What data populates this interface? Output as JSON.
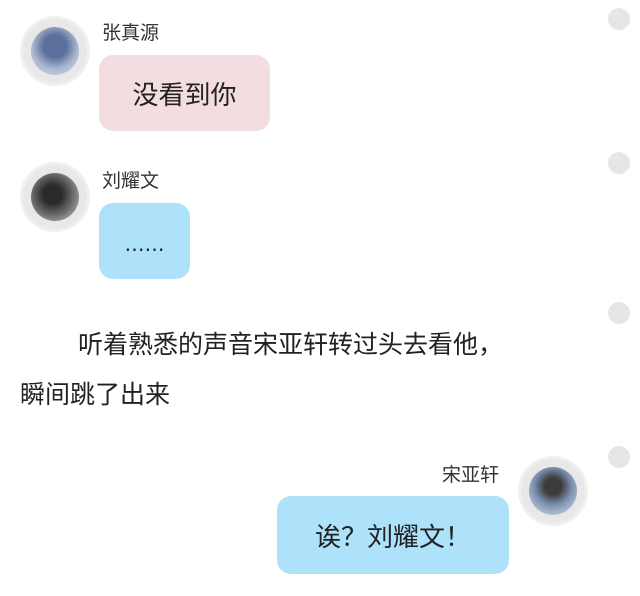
{
  "messages": [
    {
      "sender": "张真源",
      "text": "没看到你",
      "side": "left",
      "bubble_color": "#f4dde0"
    },
    {
      "sender": "刘耀文",
      "text": "……",
      "side": "left",
      "bubble_color": "#aee2fb"
    },
    {
      "sender": "宋亚轩",
      "text": "诶？刘耀文！",
      "side": "right",
      "bubble_color": "#aee2fb"
    }
  ],
  "narration": {
    "line1": "听着熟悉的声音宋亚轩转过头去看他，",
    "line2": "瞬间跳了出来"
  }
}
